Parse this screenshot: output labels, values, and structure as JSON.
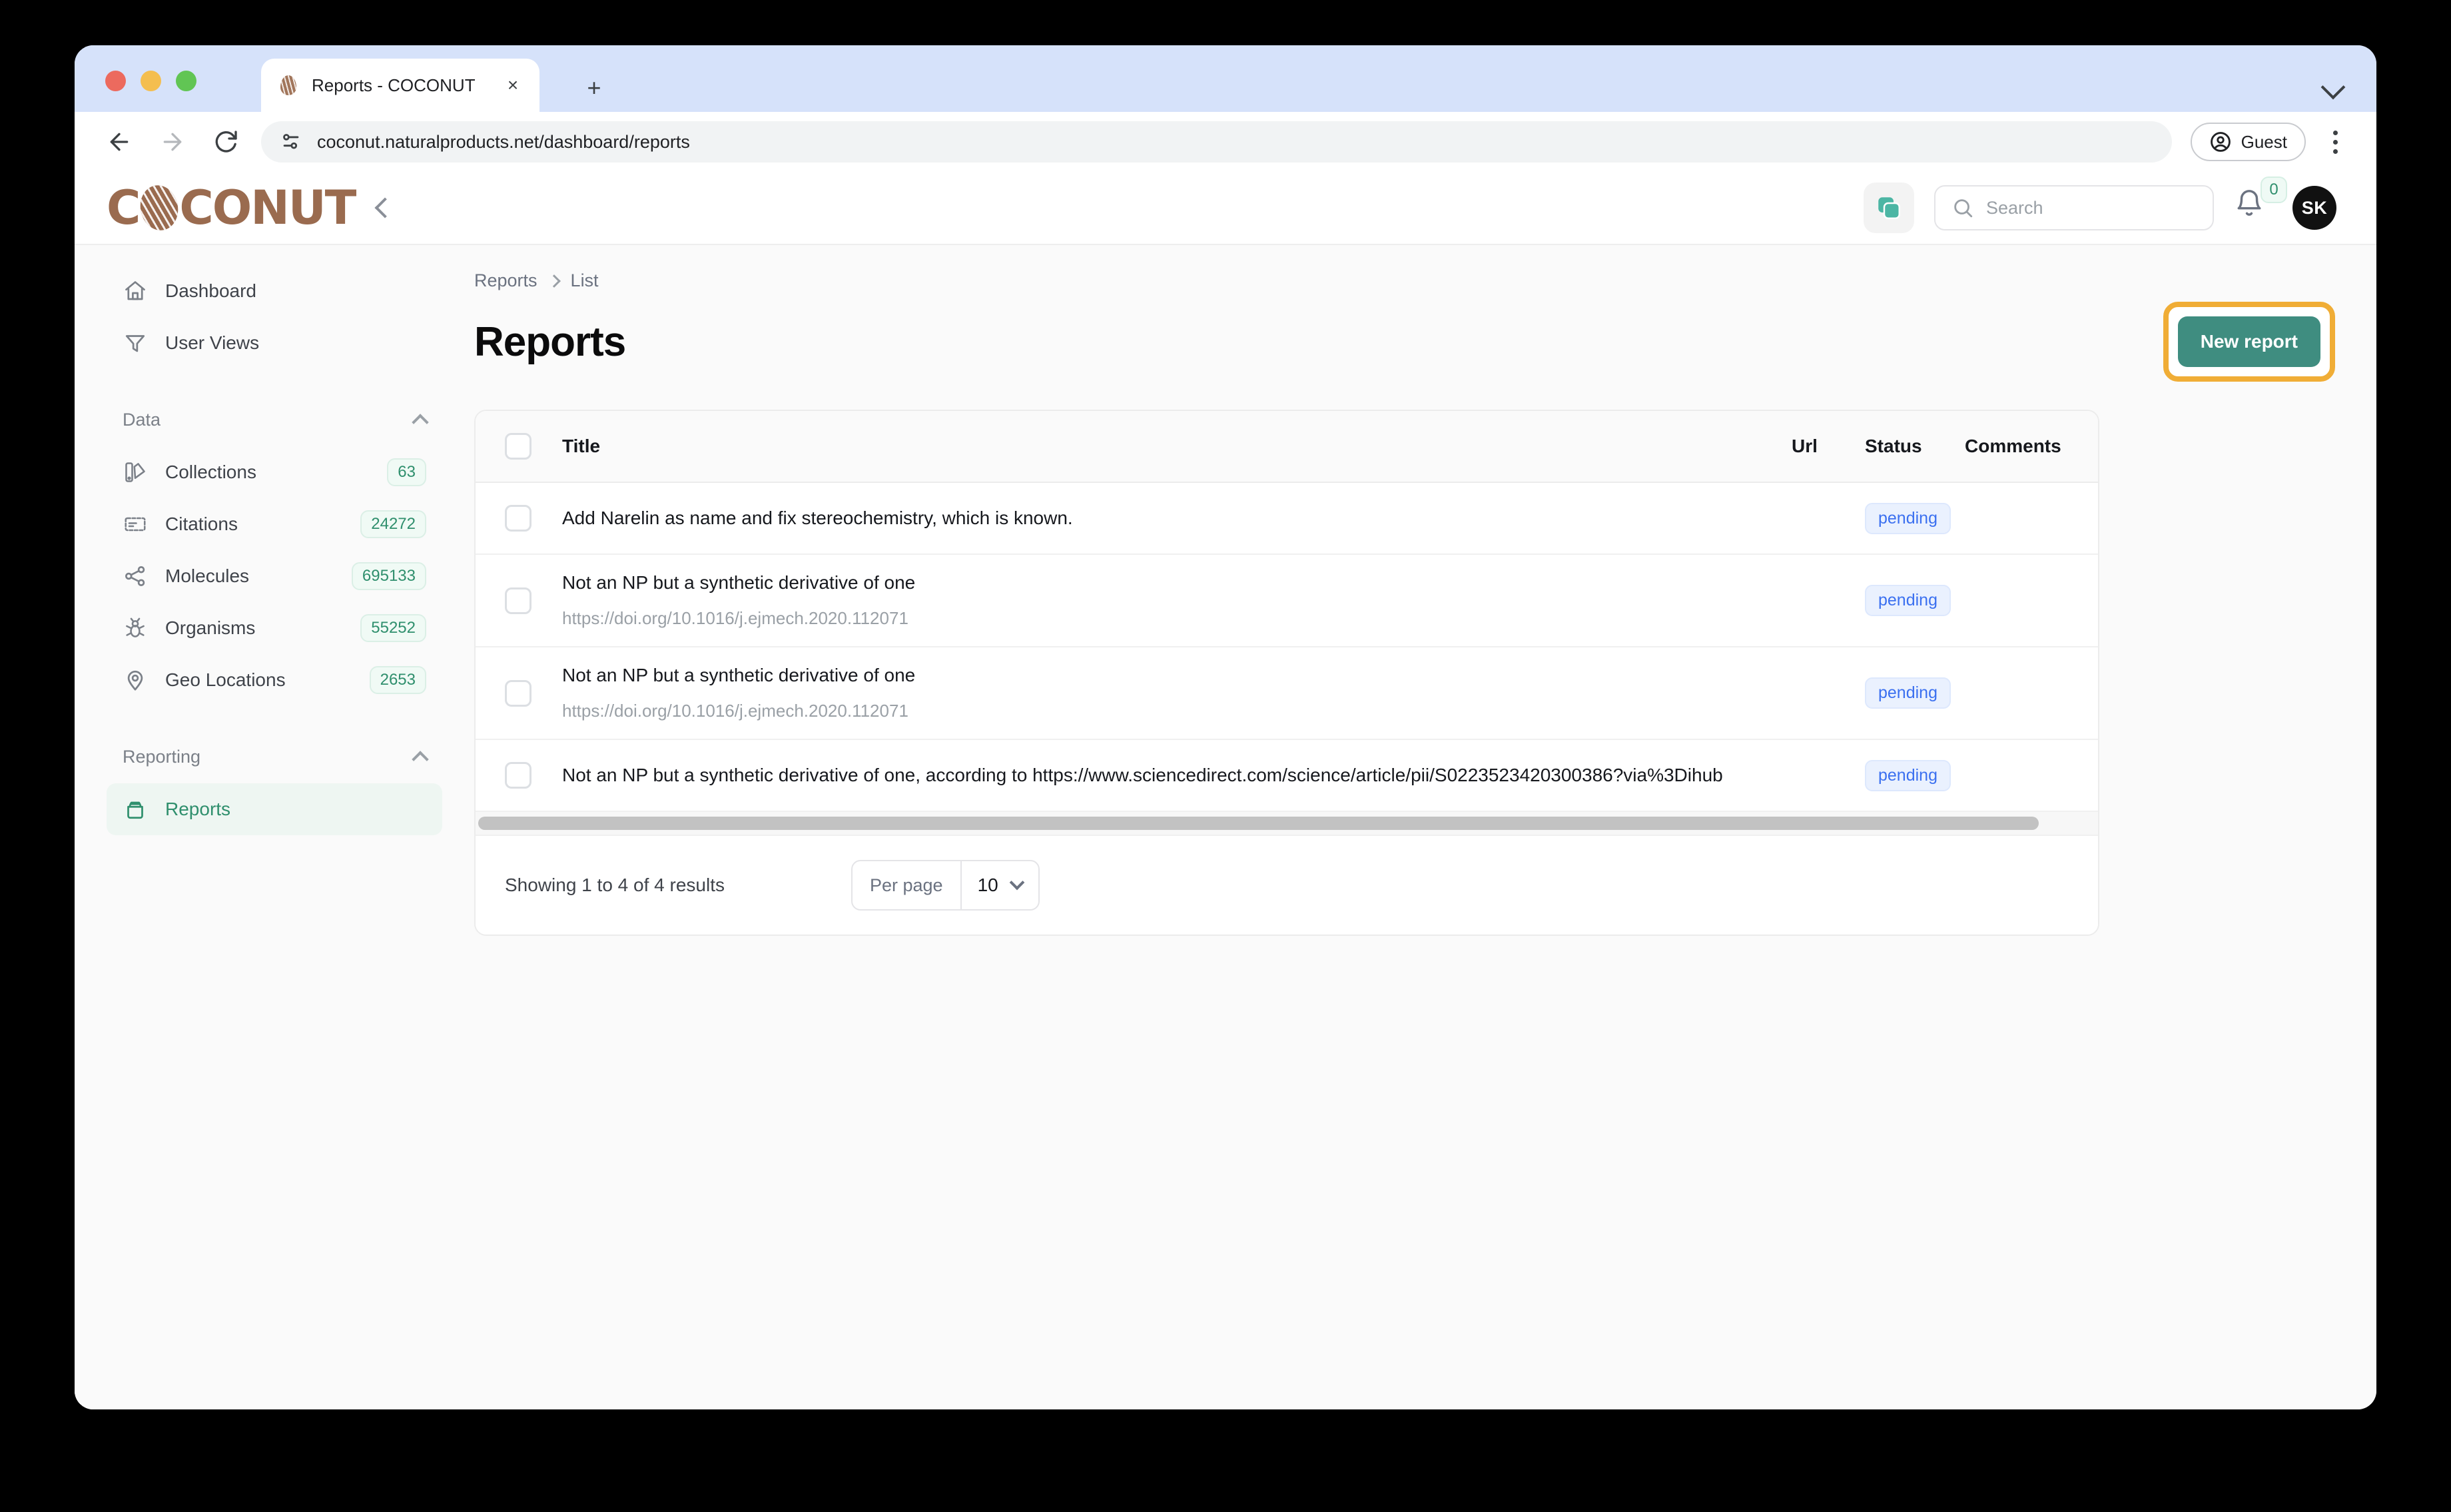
{
  "browser": {
    "tab_title": "Reports - COCONUT",
    "tab_close_label": "×",
    "new_tab_label": "+",
    "url": "coconut.naturalproducts.net/dashboard/reports",
    "profile_label": "Guest"
  },
  "app_header": {
    "logo_before": "C",
    "logo_after": "CONUT",
    "search_placeholder": "Search",
    "notification_count": "0",
    "avatar_initials": "SK"
  },
  "sidebar": {
    "top_items": [
      {
        "label": "Dashboard",
        "icon": "home-icon"
      },
      {
        "label": "User Views",
        "icon": "filter-icon"
      }
    ],
    "groups": [
      {
        "title": "Data",
        "items": [
          {
            "label": "Collections",
            "count": "63",
            "icon": "collections-icon"
          },
          {
            "label": "Citations",
            "count": "24272",
            "icon": "citation-icon"
          },
          {
            "label": "Molecules",
            "count": "695133",
            "icon": "molecule-icon"
          },
          {
            "label": "Organisms",
            "count": "55252",
            "icon": "organism-icon"
          },
          {
            "label": "Geo Locations",
            "count": "2653",
            "icon": "location-pin-icon"
          }
        ]
      },
      {
        "title": "Reporting",
        "items": [
          {
            "label": "Reports",
            "count": "",
            "icon": "reports-icon",
            "active": true
          }
        ]
      }
    ]
  },
  "main": {
    "breadcrumb": {
      "root": "Reports",
      "current": "List"
    },
    "page_title": "Reports",
    "new_report_label": "New report",
    "highlight_color": "#f0ad36",
    "accent_color": "#3f8d80",
    "table": {
      "columns": [
        "Title",
        "Url",
        "Status",
        "Comments"
      ],
      "rows": [
        {
          "title": "Add Narelin as name and fix stereochemistry, which is known.",
          "url": "",
          "status": "pending",
          "comments": ""
        },
        {
          "title": "Not an NP but a synthetic derivative of one",
          "url": "https://doi.org/10.1016/j.ejmech.2020.112071",
          "status": "pending",
          "comments": ""
        },
        {
          "title": "Not an NP but a synthetic derivative of one",
          "url": "https://doi.org/10.1016/j.ejmech.2020.112071",
          "status": "pending",
          "comments": ""
        },
        {
          "title": "Not an NP but a synthetic derivative of one, according to https://www.sciencedirect.com/science/article/pii/S0223523420300386?via%3Dihub",
          "url": "",
          "status": "pending",
          "comments": ""
        }
      ]
    },
    "footer": {
      "showing": "Showing 1 to 4 of 4 results",
      "per_page_label": "Per page",
      "per_page_value": "10"
    }
  }
}
